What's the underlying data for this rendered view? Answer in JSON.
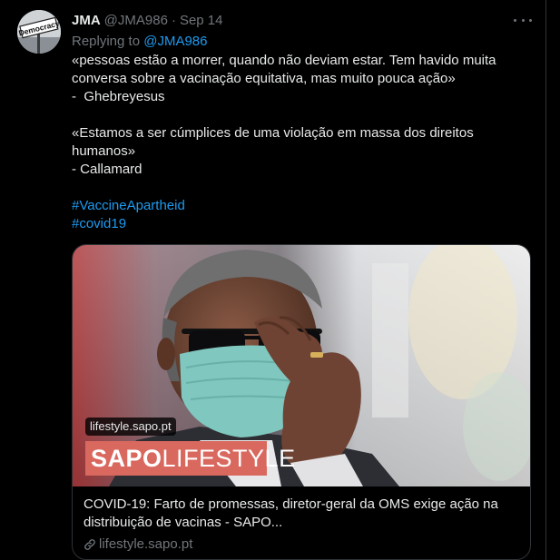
{
  "tweet": {
    "avatar": {
      "alt_text": "Democracy",
      "icon": "democracy-sign-avatar"
    },
    "author_name": "JMA",
    "author_handle": "@JMA986",
    "separator": "·",
    "date": "Sep 14",
    "more_icon": "more-horizontal-icon",
    "reply_prefix": "Replying to ",
    "reply_to": "@JMA986",
    "lines": [
      "«pessoas estão a morrer, quando não deviam estar. Tem havido muita conversa sobre a vacinação equitativa, mas muito pouca ação»",
      "-  Ghebreyesus",
      "«Estamos a ser cúmplices de uma violação em massa dos direitos humanos»",
      "- Callamard"
    ],
    "hashtags": [
      "#VaccineApartheid",
      "#covid19"
    ]
  },
  "card": {
    "image_badge": "lifestyle.sapo.pt",
    "banner_bold": "SAPO",
    "banner_light": "LIFESTYLE",
    "title": "COVID-19: Farto de promessas, diretor-geral da OMS exige ação na distribuição de vacinas - SAPO...",
    "domain": "lifestyle.sapo.pt",
    "link_icon": "link-icon"
  },
  "colors": {
    "background": "#000000",
    "text": "#e7e9ea",
    "muted": "#71767b",
    "accent": "#1d9bf0",
    "border": "#2f3336",
    "banner": "#d9685f",
    "mask": "#7fc7bf"
  }
}
